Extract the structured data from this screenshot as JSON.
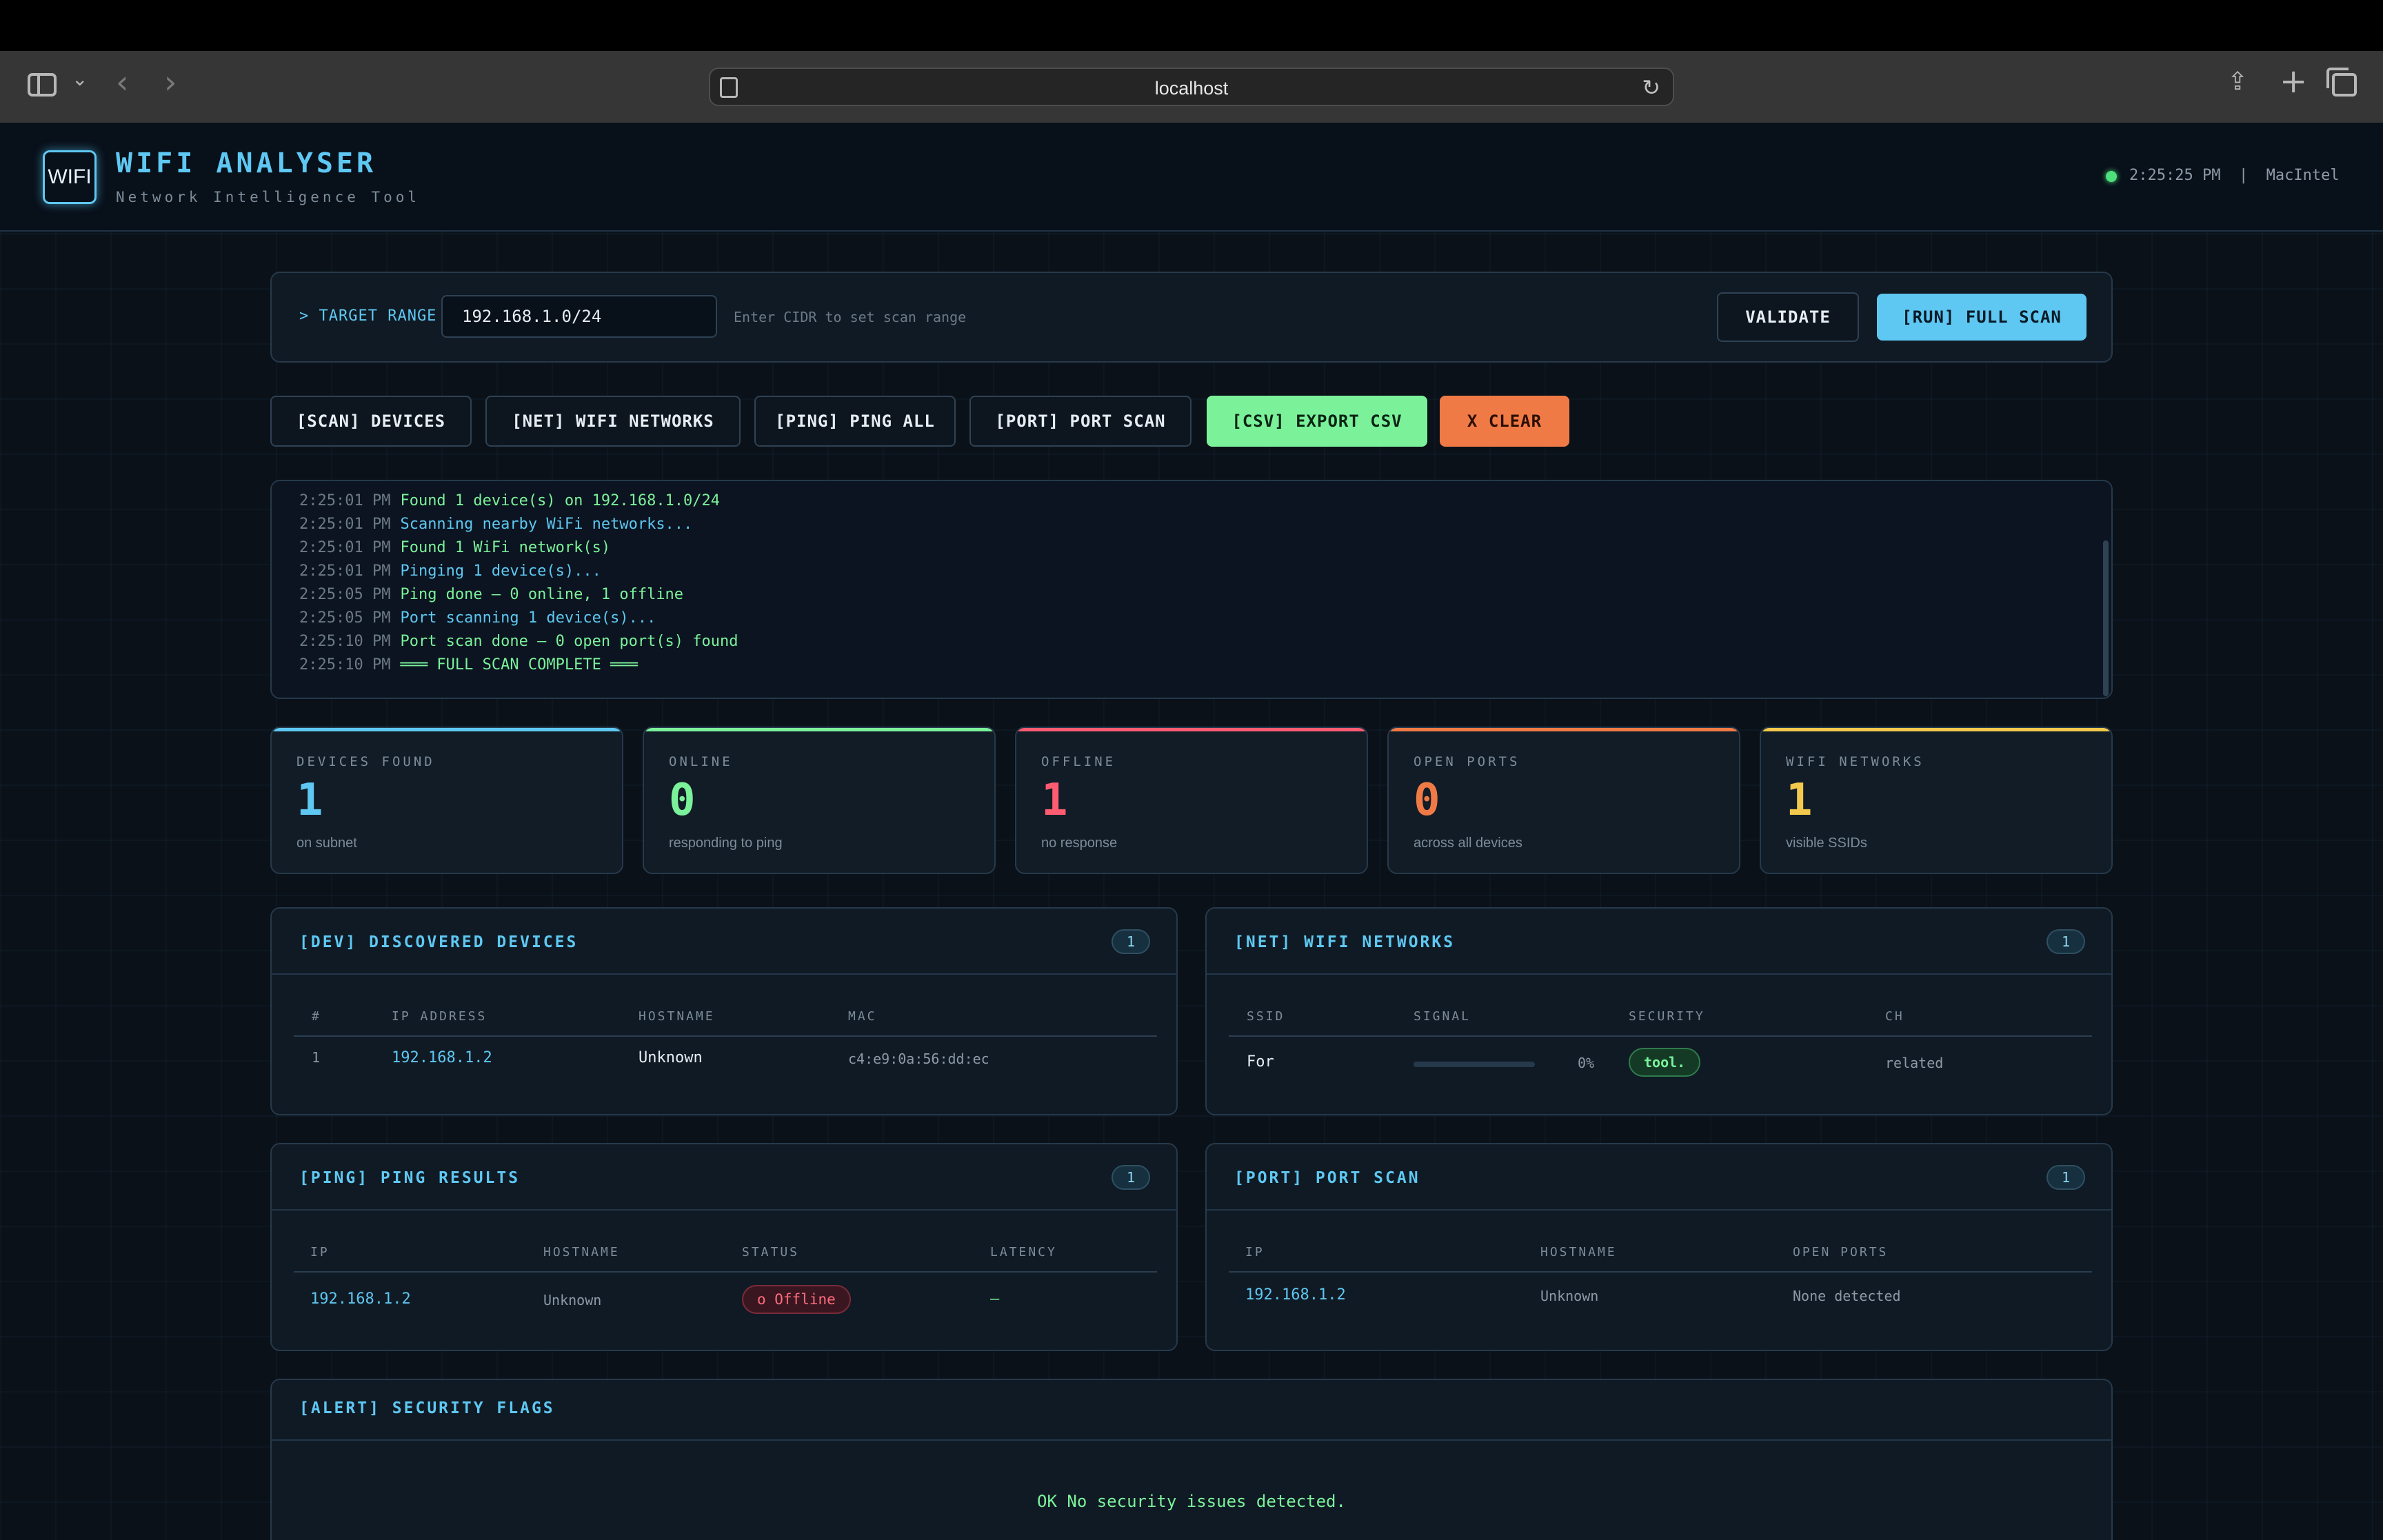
{
  "browser": {
    "address": "localhost"
  },
  "header": {
    "logo_text": "WIFI",
    "title": "WIFI ANALYSER",
    "subtitle": "Network Intelligence Tool",
    "status_text": "2:25:25 PM  |  MacIntel"
  },
  "target": {
    "label": "> TARGET RANGE",
    "value": "192.168.1.0/24",
    "hint": "Enter CIDR to set scan range",
    "validate_label": "VALIDATE",
    "run_label": "[RUN] FULL SCAN"
  },
  "actions": {
    "scan_devices": "[SCAN] DEVICES",
    "wifi_networks": "[NET] WIFI NETWORKS",
    "ping_all": "[PING] PING ALL",
    "port_scan": "[PORT] PORT SCAN",
    "export_csv": "[CSV] EXPORT CSV",
    "clear": "X CLEAR"
  },
  "log": [
    {
      "time": "2:25:01 PM",
      "msg": "Found 1 device(s) on 192.168.1.0/24",
      "tone": "green"
    },
    {
      "time": "2:25:01 PM",
      "msg": "Scanning nearby WiFi networks...",
      "tone": "blue"
    },
    {
      "time": "2:25:01 PM",
      "msg": "Found 1 WiFi network(s)",
      "tone": "green"
    },
    {
      "time": "2:25:01 PM",
      "msg": "Pinging 1 device(s)...",
      "tone": "blue"
    },
    {
      "time": "2:25:05 PM",
      "msg": "Ping done — 0 online, 1 offline",
      "tone": "green"
    },
    {
      "time": "2:25:05 PM",
      "msg": "Port scanning 1 device(s)...",
      "tone": "blue"
    },
    {
      "time": "2:25:10 PM",
      "msg": "Port scan done — 0 open port(s) found",
      "tone": "green"
    },
    {
      "time": "2:25:10 PM",
      "msg": "═══ FULL SCAN COMPLETE ═══",
      "tone": "green"
    }
  ],
  "stats": {
    "devices": {
      "label": "DEVICES FOUND",
      "value": "1",
      "sub": "on subnet"
    },
    "online": {
      "label": "ONLINE",
      "value": "0",
      "sub": "responding to ping"
    },
    "offline": {
      "label": "OFFLINE",
      "value": "1",
      "sub": "no response"
    },
    "ports": {
      "label": "OPEN PORTS",
      "value": "0",
      "sub": "across all devices"
    },
    "wifi": {
      "label": "WIFI NETWORKS",
      "value": "1",
      "sub": "visible SSIDs"
    }
  },
  "colors": {
    "accent": "#5ec8f2",
    "online": "#7bf29a",
    "offline": "#ff5c72",
    "ports": "#f07a45",
    "wifi": "#f2c94c"
  },
  "devices": {
    "title": "[DEV] DISCOVERED DEVICES",
    "count": "1",
    "headers": [
      "#",
      "IP ADDRESS",
      "HOSTNAME",
      "MAC"
    ],
    "rows": [
      {
        "num": "1",
        "ip": "192.168.1.2",
        "hostname": "Unknown",
        "mac": "c4:e9:0a:56:dd:ec"
      }
    ]
  },
  "wifi": {
    "title": "[NET] WIFI NETWORKS",
    "count": "1",
    "headers": [
      "SSID",
      "SIGNAL",
      "SECURITY",
      "CH"
    ],
    "rows": [
      {
        "ssid": "For",
        "signal": "0%",
        "signal_value": 0,
        "security": "tool.",
        "channel": "related"
      }
    ]
  },
  "ping": {
    "title": "[PING] PING RESULTS",
    "count": "1",
    "headers": [
      "IP",
      "HOSTNAME",
      "STATUS",
      "LATENCY"
    ],
    "rows": [
      {
        "ip": "192.168.1.2",
        "hostname": "Unknown",
        "status": "o Offline",
        "latency": "—"
      }
    ]
  },
  "ports": {
    "title": "[PORT] PORT SCAN",
    "count": "1",
    "headers": [
      "IP",
      "HOSTNAME",
      "OPEN PORTS"
    ],
    "rows": [
      {
        "ip": "192.168.1.2",
        "hostname": "Unknown",
        "open_ports": "None detected"
      }
    ]
  },
  "security": {
    "title": "[ALERT] SECURITY FLAGS",
    "message": "OK No security issues detected."
  }
}
